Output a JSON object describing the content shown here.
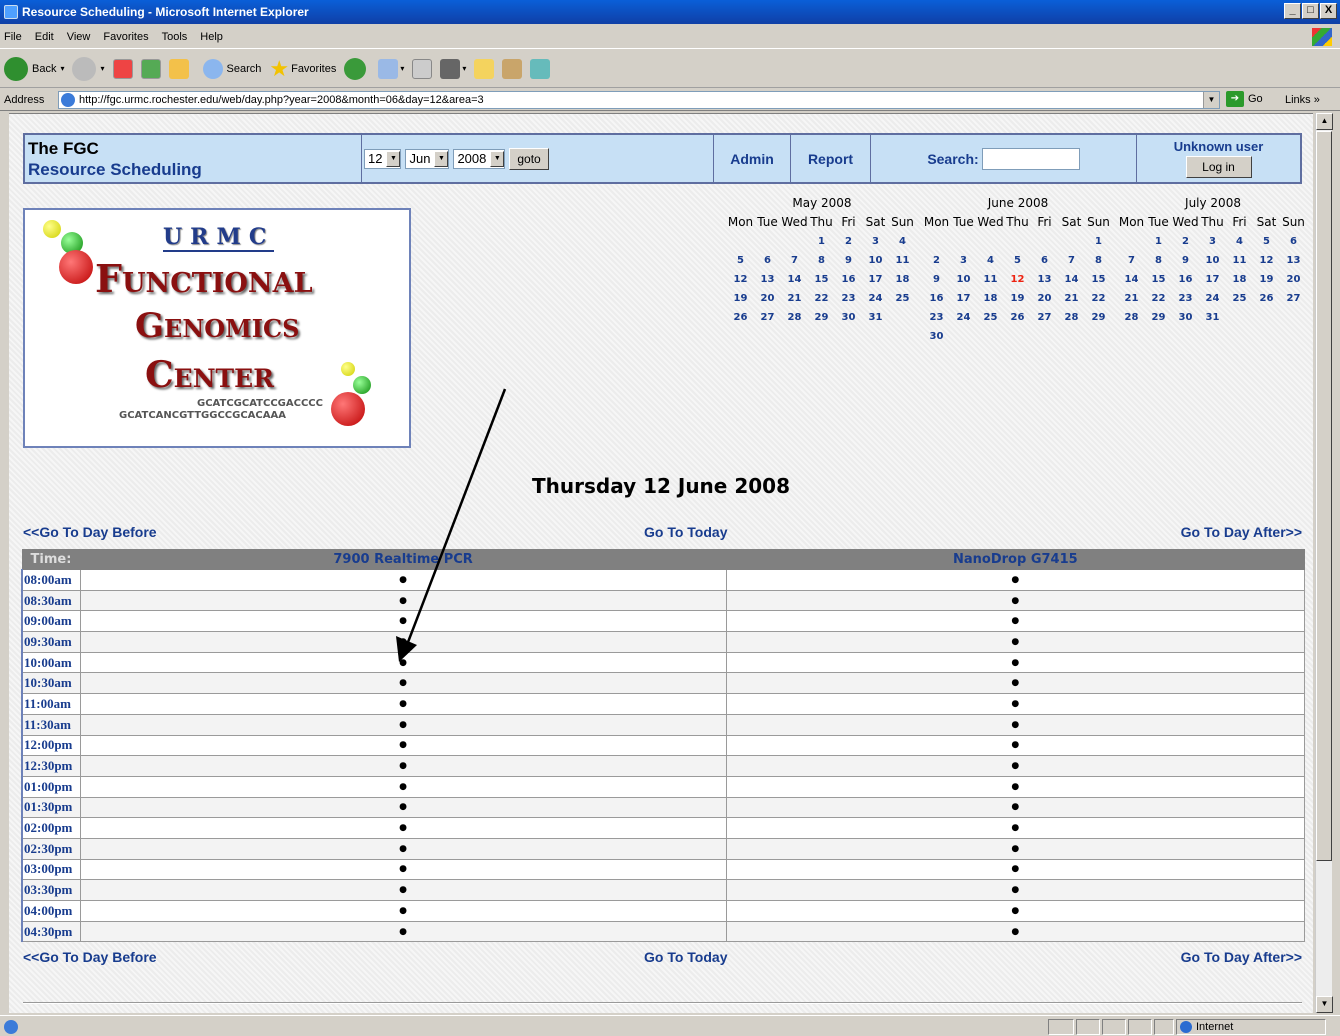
{
  "window": {
    "title": "Resource Scheduling - Microsoft Internet Explorer",
    "controls": [
      "_",
      "□",
      "X"
    ]
  },
  "menu": [
    "File",
    "Edit",
    "View",
    "Favorites",
    "Tools",
    "Help"
  ],
  "toolbar": {
    "back": "Back",
    "search": "Search",
    "favorites": "Favorites"
  },
  "address": {
    "label": "Address",
    "url": "http://fgc.urmc.rochester.edu/web/day.php?year=2008&month=06&day=12&area=3",
    "go": "Go",
    "links": "Links"
  },
  "header": {
    "title_line1": "The FGC",
    "title_line2": "Resource Scheduling",
    "day": "12",
    "month": "Jun",
    "year": "2008",
    "goto": "goto",
    "admin": "Admin",
    "report": "Report",
    "search_label": "Search:",
    "search_value": "",
    "user": "Unknown user",
    "login": "Log in"
  },
  "logo": {
    "urmc": "URMC",
    "line1": "Functional",
    "line2": "Genomics",
    "line3": "Center",
    "seq1": "GCATCGCATCCGACCCC",
    "seq2": "GCATCANCGTTGGCCGCACAAA"
  },
  "calendars": [
    {
      "title": "May 2008",
      "dow": [
        "Mon",
        "Tue",
        "Wed",
        "Thu",
        "Fri",
        "Sat",
        "Sun"
      ],
      "weeks": [
        [
          "",
          "",
          "",
          "1",
          "2",
          "3",
          "4"
        ],
        [
          "5",
          "6",
          "7",
          "8",
          "9",
          "10",
          "11"
        ],
        [
          "12",
          "13",
          "14",
          "15",
          "16",
          "17",
          "18"
        ],
        [
          "19",
          "20",
          "21",
          "22",
          "23",
          "24",
          "25"
        ],
        [
          "26",
          "27",
          "28",
          "29",
          "30",
          "31",
          ""
        ]
      ]
    },
    {
      "title": "June 2008",
      "dow": [
        "Mon",
        "Tue",
        "Wed",
        "Thu",
        "Fri",
        "Sat",
        "Sun"
      ],
      "today": "12",
      "weeks": [
        [
          "",
          "",
          "",
          "",
          "",
          "",
          "1"
        ],
        [
          "2",
          "3",
          "4",
          "5",
          "6",
          "7",
          "8"
        ],
        [
          "9",
          "10",
          "11",
          "12",
          "13",
          "14",
          "15"
        ],
        [
          "16",
          "17",
          "18",
          "19",
          "20",
          "21",
          "22"
        ],
        [
          "23",
          "24",
          "25",
          "26",
          "27",
          "28",
          "29"
        ],
        [
          "30",
          "",
          "",
          "",
          "",
          "",
          ""
        ]
      ]
    },
    {
      "title": "July 2008",
      "dow": [
        "Mon",
        "Tue",
        "Wed",
        "Thu",
        "Fri",
        "Sat",
        "Sun"
      ],
      "weeks": [
        [
          "",
          "1",
          "2",
          "3",
          "4",
          "5",
          "6"
        ],
        [
          "7",
          "8",
          "9",
          "10",
          "11",
          "12",
          "13"
        ],
        [
          "14",
          "15",
          "16",
          "17",
          "18",
          "19",
          "20"
        ],
        [
          "21",
          "22",
          "23",
          "24",
          "25",
          "26",
          "27"
        ],
        [
          "28",
          "29",
          "30",
          "31",
          "",
          "",
          ""
        ]
      ]
    }
  ],
  "date_title": "Thursday 12 June 2008",
  "nav": {
    "before": "<<Go To Day Before",
    "today": "Go To Today",
    "after": "Go To Day After>>"
  },
  "schedule": {
    "time_header": "Time:",
    "resources": [
      "7900 Realtime PCR",
      "NanoDrop G7415"
    ],
    "times": [
      "08:00am",
      "08:30am",
      "09:00am",
      "09:30am",
      "10:00am",
      "10:30am",
      "11:00am",
      "11:30am",
      "12:00pm",
      "12:30pm",
      "01:00pm",
      "01:30pm",
      "02:00pm",
      "02:30pm",
      "03:00pm",
      "03:30pm",
      "04:00pm",
      "04:30pm"
    ],
    "slot_symbol": "●"
  },
  "status": {
    "zone": "Internet"
  }
}
